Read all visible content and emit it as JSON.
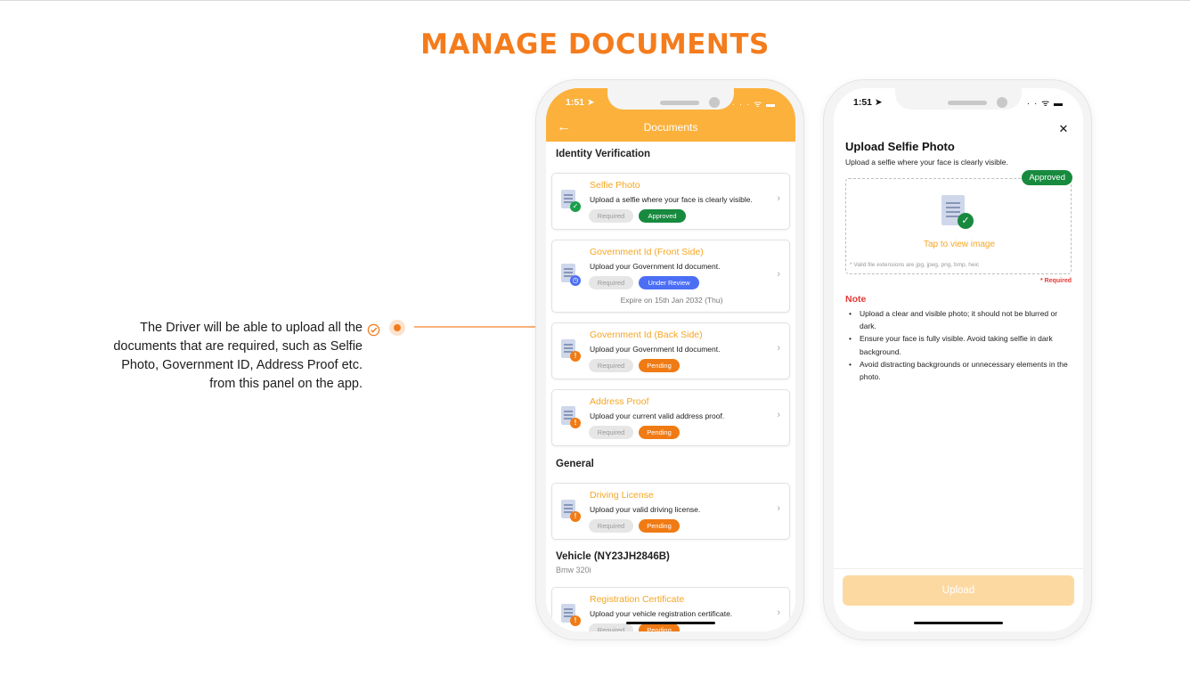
{
  "page": {
    "title": "MANAGE DOCUMENTS"
  },
  "description": {
    "lines": [
      "The Driver will be able to upload all the",
      "documents that are required, such as Selfie",
      "Photo, Government ID, Address Proof etc.",
      "from this panel on the app."
    ]
  },
  "phone1": {
    "status_time": "1:51 ➤",
    "status_icons": "· · ·  ᯤ ▬",
    "header_title": "Documents",
    "back_icon": "arrow-left-icon",
    "sections": {
      "identity": "Identity Verification",
      "general": "General",
      "vehicle": "Vehicle (NY23JH2846B)",
      "vehicle_sub": "Bmw 320i"
    },
    "documents": [
      {
        "title": "Selfie Photo",
        "desc": "Upload a selfie where your face is clearly visible.",
        "required": "Required",
        "status": "Approved",
        "badge": "✓"
      },
      {
        "title": "Government Id (Front Side)",
        "desc": "Upload your Government Id document.",
        "required": "Required",
        "status": "Under Review",
        "badge": "◷",
        "expire": "Expire on 15th Jan 2032 (Thu)"
      },
      {
        "title": "Government Id (Back Side)",
        "desc": "Upload your Government Id document.",
        "required": "Required",
        "status": "Pending",
        "badge": "!"
      },
      {
        "title": "Address Proof",
        "desc": "Upload your current valid address proof.",
        "required": "Required",
        "status": "Pending",
        "badge": "!"
      },
      {
        "title": "Driving License",
        "desc": "Upload your valid driving license.",
        "required": "Required",
        "status": "Pending",
        "badge": "!"
      },
      {
        "title": "Registration Certificate",
        "desc": "Upload your vehicle registration certificate.",
        "required": "Required",
        "status": "Pending",
        "badge": "!"
      }
    ],
    "chevron": "›"
  },
  "phone2": {
    "status_time": "1:51 ➤",
    "status_icons": "· ·  ᯤ ▬",
    "close": "✕",
    "title": "Upload Selfie Photo",
    "subtitle": "Upload a selfie where your face is clearly visible.",
    "status": "Approved",
    "tap_view": "Tap to view image",
    "valid_ext": "* Valid file extensions are jpg, jpeg, png, bmp, heic",
    "required": "* Required",
    "note_title": "Note",
    "notes": [
      "Upload a clear and visible photo; it should not be blurred or dark.",
      "Ensure your face is fully visible. Avoid taking selfie in dark background.",
      "Avoid distracting backgrounds or unnecessary elements in the photo."
    ],
    "upload_label": "Upload"
  },
  "colors": {
    "accent": "#f47c1c",
    "header": "#fbb13c",
    "approved": "#178a3e",
    "review": "#4c6ef5",
    "pending": "#f07b14"
  }
}
